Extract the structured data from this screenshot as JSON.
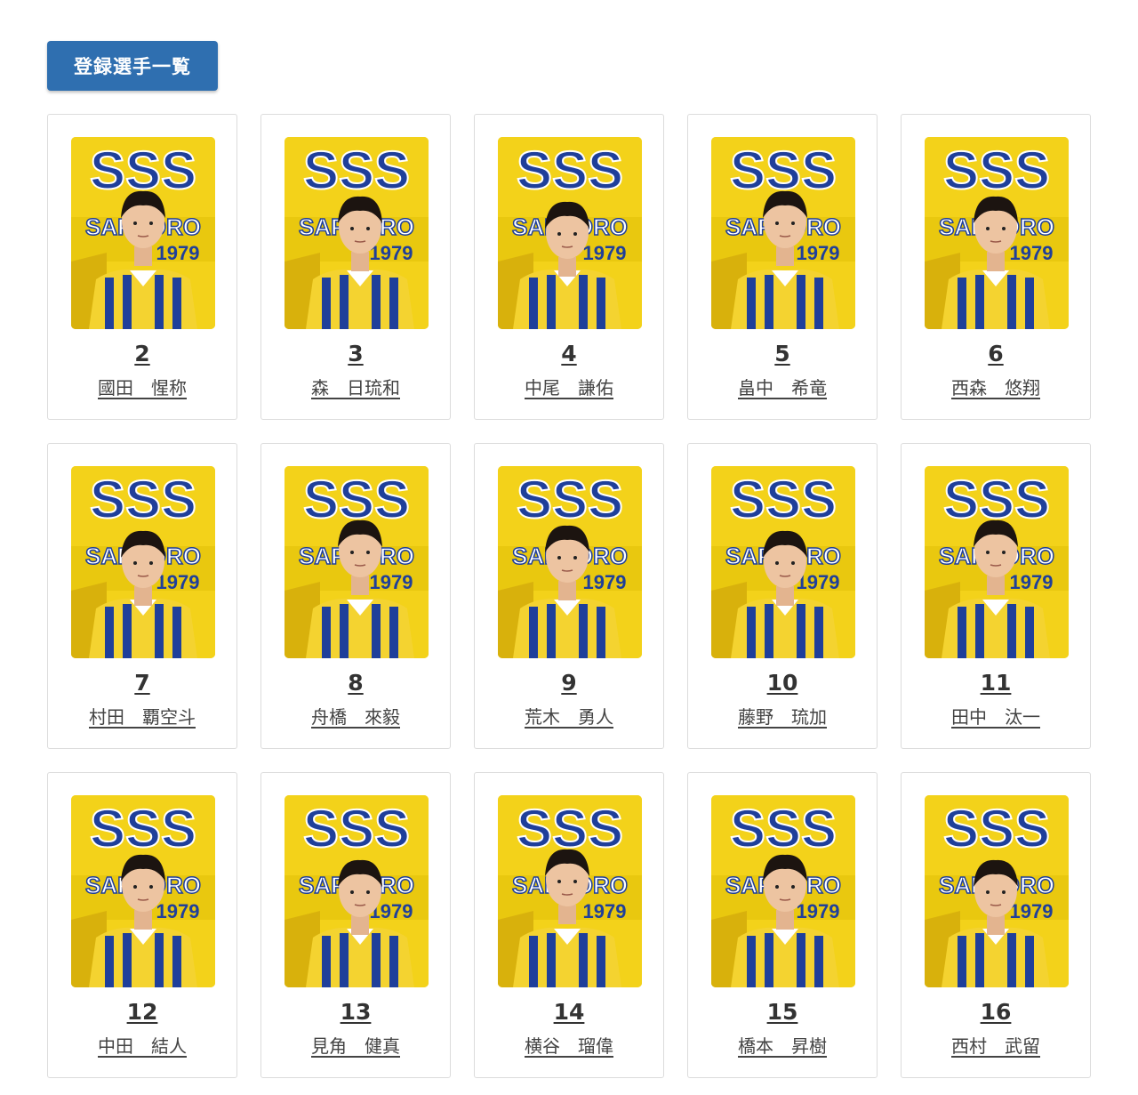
{
  "header": {
    "button_label": "登録選手一覧"
  },
  "photo_text": {
    "logo": "SSS",
    "city": "SAPPORO",
    "year": "1979"
  },
  "colors": {
    "button": "#2f6fb0",
    "yellow": "#f3d21a",
    "blue": "#1f3f9a"
  },
  "players": [
    {
      "number": "2",
      "name": "國田　惺称"
    },
    {
      "number": "3",
      "name": "森　日琉和"
    },
    {
      "number": "4",
      "name": "中尾　謙佑"
    },
    {
      "number": "5",
      "name": "畠中　希竜"
    },
    {
      "number": "6",
      "name": "西森　悠翔"
    },
    {
      "number": "7",
      "name": "村田　覇空斗"
    },
    {
      "number": "8",
      "name": "舟橋　來毅"
    },
    {
      "number": "9",
      "name": "荒木　勇人"
    },
    {
      "number": "10",
      "name": "藤野　琉加"
    },
    {
      "number": "11",
      "name": "田中　汰一"
    },
    {
      "number": "12",
      "name": "中田　結人"
    },
    {
      "number": "13",
      "name": "見角　健真"
    },
    {
      "number": "14",
      "name": "横谷　瑠偉"
    },
    {
      "number": "15",
      "name": "橋本　昇樹"
    },
    {
      "number": "16",
      "name": "西村　武留"
    }
  ]
}
